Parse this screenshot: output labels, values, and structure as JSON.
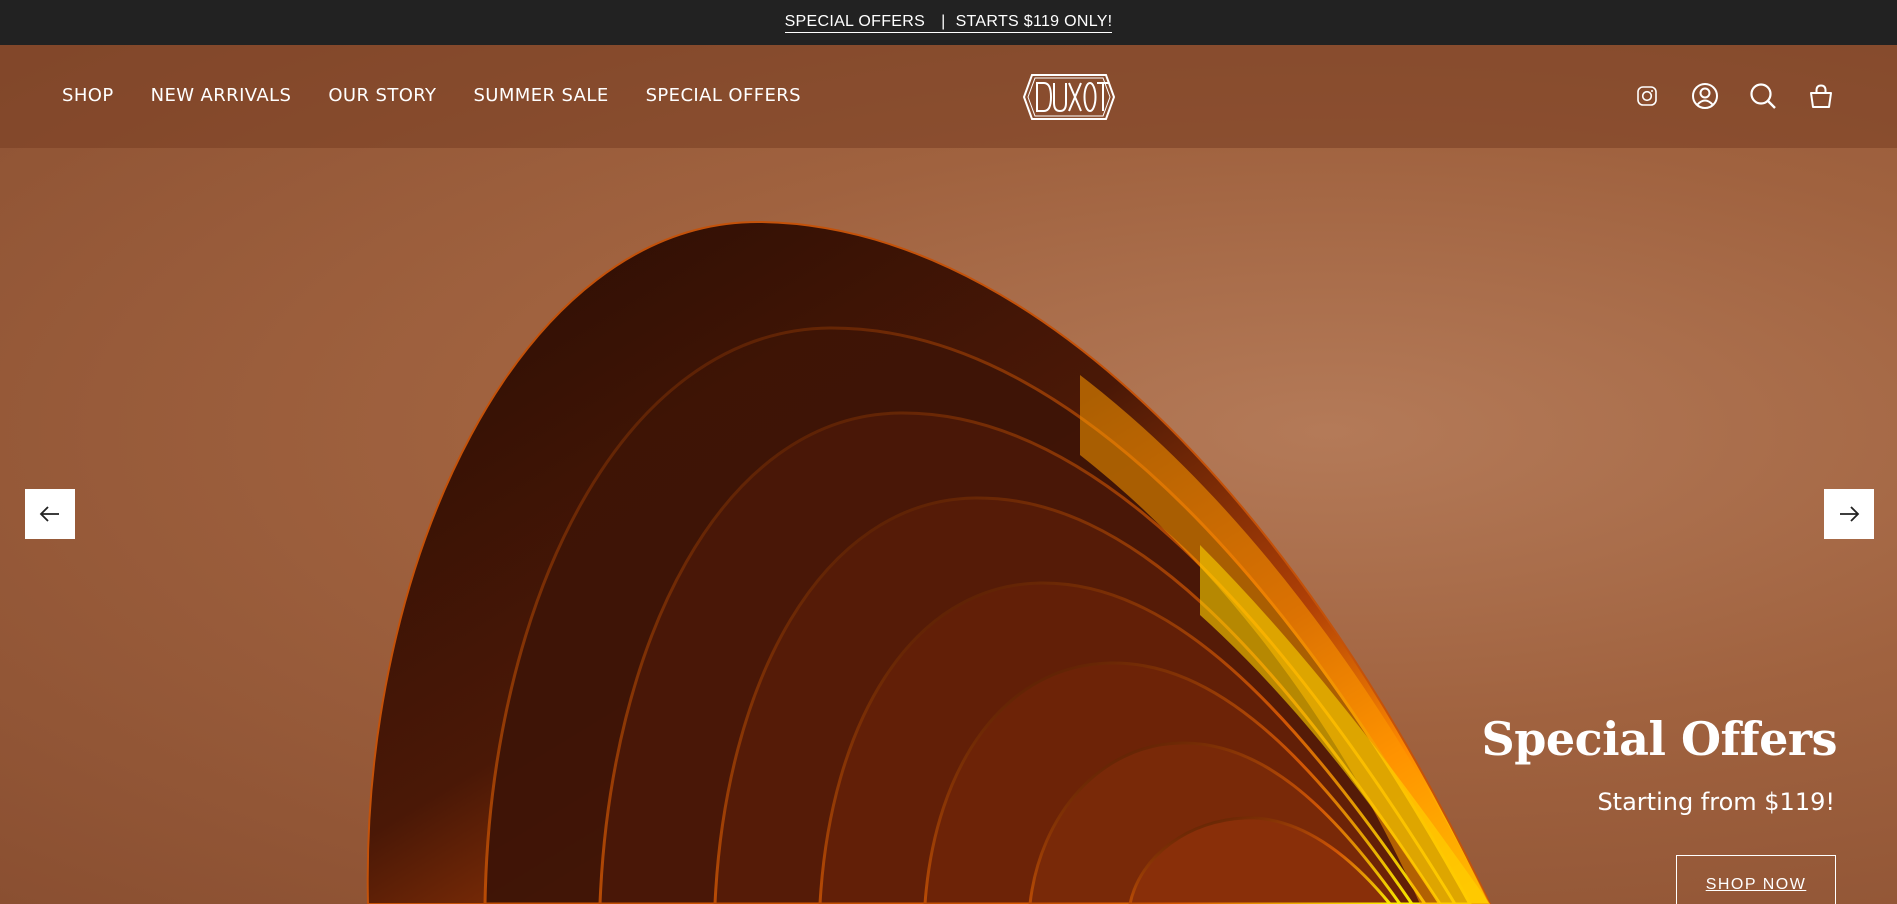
{
  "announcement": {
    "link_text": "SPECIAL OFFERS",
    "separator": "|",
    "promo_text": "STARTS $119 ONLY!"
  },
  "header": {
    "nav": [
      "SHOP",
      "NEW ARRIVALS",
      "OUR STORY",
      "SUMMER SALE",
      "SPECIAL OFFERS"
    ],
    "logo_text": "DUXOT",
    "icons": [
      "instagram-icon",
      "account-icon",
      "search-icon",
      "cart-icon"
    ]
  },
  "hero": {
    "title": "Special Offers",
    "subtitle": "Starting from $119!",
    "button_label": "SHOP NOW",
    "prev_icon": "arrow-left-icon",
    "next_icon": "arrow-right-icon"
  },
  "colors": {
    "announcement_bg": "#222222",
    "hero_bg": "#a0603f",
    "accent_orange": "#ff8c00",
    "accent_yellow": "#ffe100",
    "text": "#ffffff"
  }
}
